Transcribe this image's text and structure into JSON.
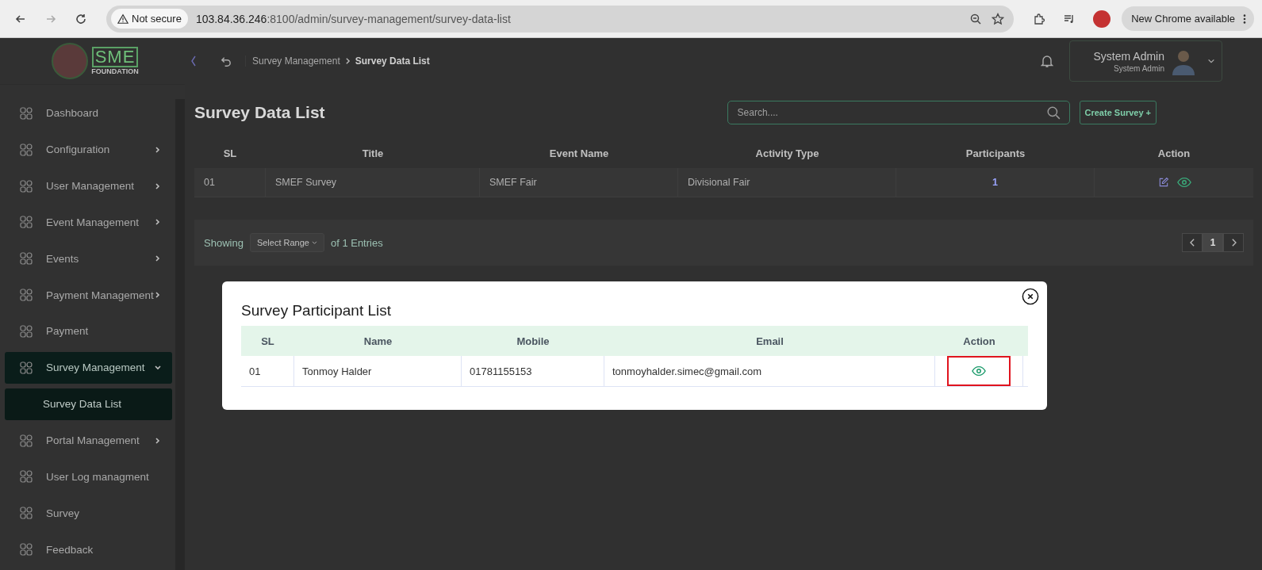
{
  "browser": {
    "security_label": "Not secure",
    "url_host": "103.84.36.246",
    "url_rest": ":8100/admin/survey-management/survey-data-list",
    "update_label": "New Chrome available"
  },
  "logo": {
    "wordmark": "SME",
    "tagline": "FOUNDATION"
  },
  "header": {
    "breadcrumb": [
      {
        "label": "Survey Management",
        "current": false
      },
      {
        "label": "Survey Data List",
        "current": true
      }
    ],
    "user": {
      "name": "System Admin",
      "role": "System Admin"
    }
  },
  "sidebar": {
    "items": [
      {
        "label": "Dashboard",
        "has_submenu": false,
        "selected": false
      },
      {
        "label": "Configuration",
        "has_submenu": true,
        "expanded": false,
        "selected": false
      },
      {
        "label": "User Management",
        "has_submenu": true,
        "expanded": false,
        "selected": false
      },
      {
        "label": "Event Management",
        "has_submenu": true,
        "expanded": false,
        "selected": false
      },
      {
        "label": "Events",
        "has_submenu": true,
        "expanded": false,
        "selected": false
      },
      {
        "label": "Payment Management",
        "has_submenu": true,
        "expanded": false,
        "selected": false
      },
      {
        "label": "Payment",
        "has_submenu": false,
        "selected": false
      },
      {
        "label": "Survey Management",
        "has_submenu": true,
        "expanded": true,
        "selected": true,
        "children": [
          {
            "label": "Survey Data List",
            "selected": true
          }
        ]
      },
      {
        "label": "Portal Management",
        "has_submenu": true,
        "expanded": false,
        "selected": false
      },
      {
        "label": "User Log managment",
        "has_submenu": false,
        "selected": false
      },
      {
        "label": "Survey",
        "has_submenu": false,
        "selected": false
      },
      {
        "label": "Feedback",
        "has_submenu": false,
        "selected": false
      }
    ]
  },
  "page": {
    "title": "Survey Data List",
    "search": {
      "placeholder": "Search...."
    },
    "create_button": "Create Survey +",
    "table": {
      "columns": [
        "SL",
        "Title",
        "Event Name",
        "Activity Type",
        "Participants",
        "Action"
      ],
      "rows": [
        {
          "sl": "01",
          "title": "SMEF Survey",
          "event_name": "SMEF Fair",
          "activity_type": "Divisional Fair",
          "participants": "1"
        }
      ]
    },
    "footer": {
      "showing": "Showing",
      "range_select": "Select Range",
      "entries": "of 1 Entries",
      "pages": [
        {
          "label": "1",
          "selected": true
        }
      ]
    }
  },
  "modal": {
    "title": "Survey Participant List",
    "columns": [
      "SL",
      "Name",
      "Mobile",
      "Email",
      "Action"
    ],
    "rows": [
      {
        "sl": "01",
        "name": "Tonmoy Halder",
        "mobile": "01781155153",
        "email": "tonmoyhalder.simec@gmail.com",
        "highlighted": true
      }
    ]
  }
}
